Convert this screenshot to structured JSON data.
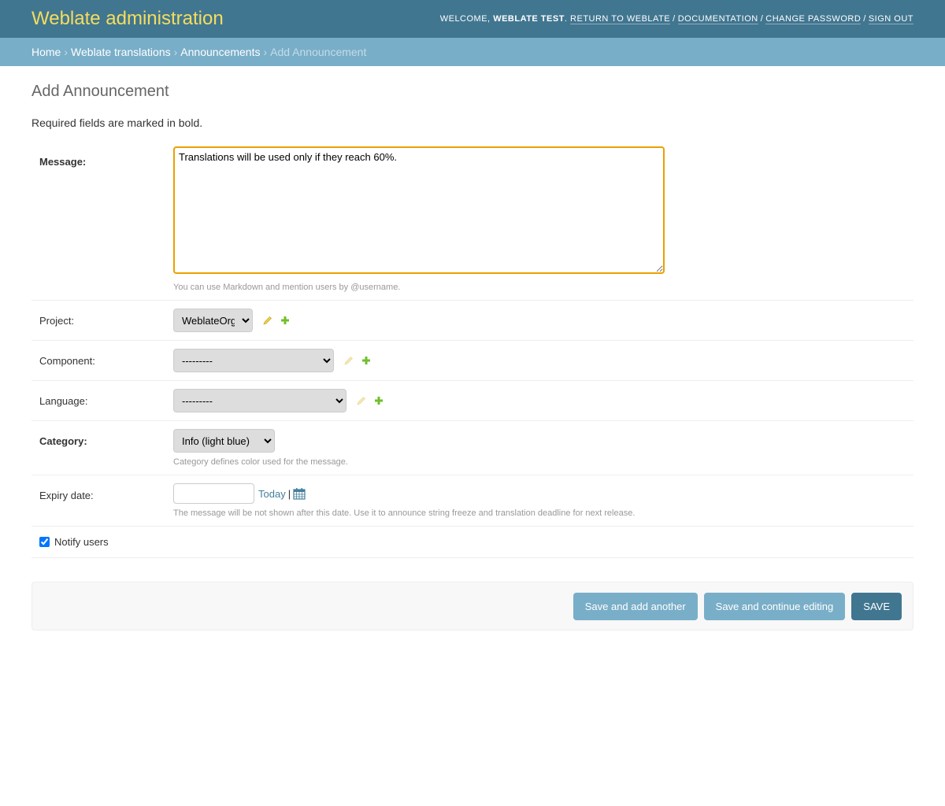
{
  "header": {
    "title": "Weblate administration",
    "welcome": "Welcome,",
    "username": "Weblate Test",
    "links": [
      "Return to Weblate",
      "Documentation",
      "Change password",
      "Sign out"
    ]
  },
  "breadcrumbs": [
    "Home",
    "Weblate translations",
    "Announcements",
    "Add Announcement"
  ],
  "page_title": "Add Announcement",
  "required_note": "Required fields are marked in bold.",
  "form": {
    "message": {
      "label": "Message:",
      "value": "Translations will be used only if they reach 60%.",
      "help": "You can use Markdown and mention users by @username."
    },
    "project": {
      "label": "Project:",
      "selected": "WeblateOrg"
    },
    "component": {
      "label": "Component:",
      "selected": "---------"
    },
    "language": {
      "label": "Language:",
      "selected": "---------"
    },
    "category": {
      "label": "Category:",
      "selected": "Info (light blue)",
      "help": "Category defines color used for the message."
    },
    "expiry": {
      "label": "Expiry date:",
      "value": "",
      "today": "Today",
      "separator": "|",
      "help": "The message will be not shown after this date. Use it to announce string freeze and translation deadline for next release."
    },
    "notify": {
      "label": "Notify users",
      "checked": true
    }
  },
  "buttons": {
    "save_add_another": "Save and add another",
    "save_continue": "Save and continue editing",
    "save": "Save"
  },
  "colors": {
    "header_bg": "#417690",
    "breadcrumb_bg": "#79aec8",
    "brand": "#f5dd5d",
    "focus_border": "#eba000",
    "icon_edit": "#efd043",
    "icon_add": "#70bf2b"
  },
  "icons": {
    "edit": "pencil-icon",
    "add": "plus-icon",
    "calendar": "calendar-icon"
  }
}
